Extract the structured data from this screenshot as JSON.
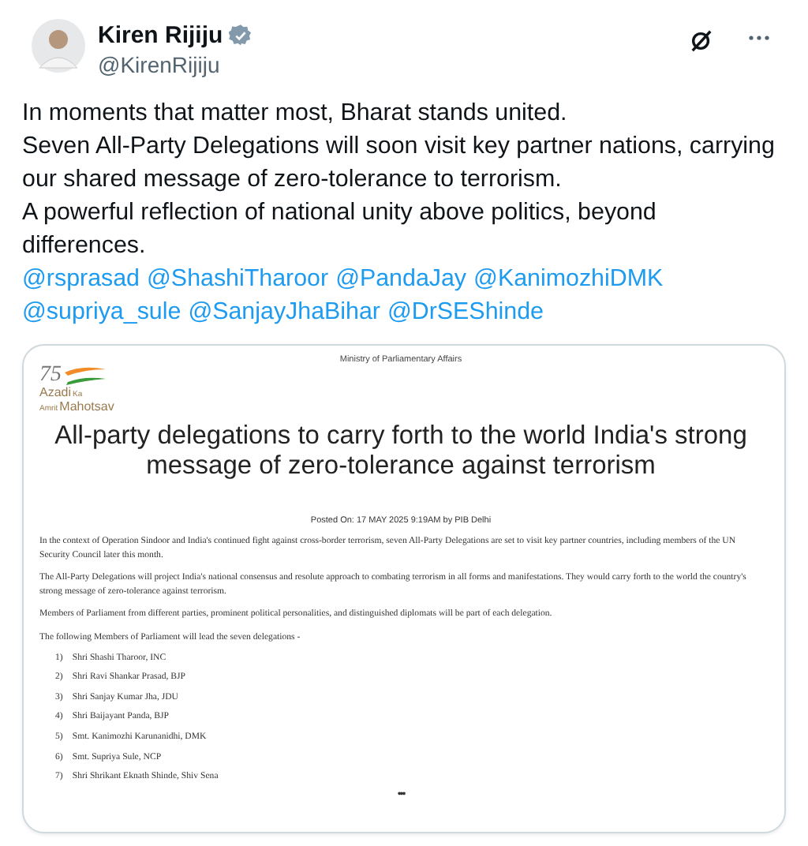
{
  "author": {
    "name": "Kiren Rijiju",
    "handle": "@KirenRijiju",
    "verified": true
  },
  "post": {
    "paragraphs": [
      "In moments that matter most, Bharat stands united.",
      "Seven All-Party Delegations will soon visit key partner nations, carrying our shared message of zero-tolerance to terrorism.",
      "A powerful reflection of national unity above politics, beyond differences."
    ],
    "mentions": [
      "@rsprasad",
      "@ShashiTharoor",
      "@PandaJay",
      "@KanimozhiDMK",
      "@supriya_sule",
      "@SanjayJhaBihar",
      "@DrSEShinde"
    ]
  },
  "document": {
    "ministry": "Ministry of Parliamentary Affairs",
    "logo": {
      "number": "75",
      "line_1": "Azadi",
      "line_1_small": "Ka",
      "line_2_small": "Amrit",
      "line_2": "Mahotsav"
    },
    "title": "All-party delegations to carry forth to the world India's strong message of zero-tolerance against terrorism",
    "posted": "Posted On: 17 MAY 2025 9:19AM by PIB Delhi",
    "paragraphs": [
      "In the context of Operation Sindoor and India's continued  fight against cross-border terrorism, seven  All-Party Delegations are set to  visit key partner countries, including members of the UN Security Council later this month.",
      "The All-Party Delegations will project India's national consensus and resolute approach to combating terrorism in all forms and manifestations. They would carry forth to the world the country's strong message of zero-tolerance against terrorism.",
      "Members of Parliament from different parties, prominent political personalities, and distinguished diplomats will be part of each delegation.",
      "The following Members of Parliament will lead the seven delegations -"
    ],
    "leaders": [
      {
        "number": "1)",
        "name": "Shri Shashi Tharoor, INC"
      },
      {
        "number": "2)",
        "name": "Shri Ravi Shankar Prasad, BJP"
      },
      {
        "number": "3)",
        "name": "Shri Sanjay Kumar Jha, JDU"
      },
      {
        "number": "4)",
        "name": "Shri Baijayant Panda, BJP"
      },
      {
        "number": "5)",
        "name": "Smt. Kanimozhi Karunanidhi, DMK"
      },
      {
        "number": "6)",
        "name": "Smt. Supriya Sule, NCP"
      },
      {
        "number": "7)",
        "name": "Shri Shrikant Eknath Shinde, Shiv Sena"
      }
    ],
    "more": "•••"
  }
}
